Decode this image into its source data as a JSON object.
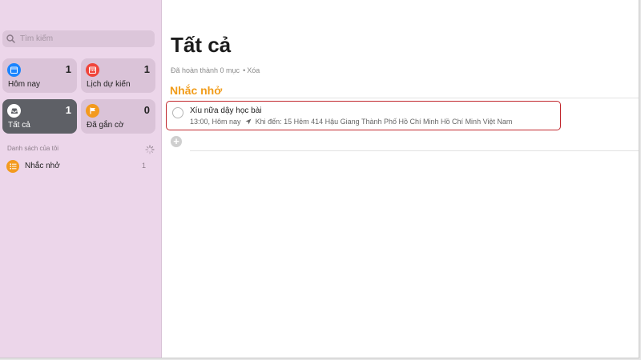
{
  "sidebar": {
    "search": {
      "placeholder": "Tìm kiếm"
    },
    "smart_lists": [
      {
        "label": "Hôm nay",
        "count": "1",
        "icon": "calendar-today-icon",
        "color": "#1a84ff"
      },
      {
        "label": "Lịch dự kiến",
        "count": "1",
        "icon": "calendar-scheduled-icon",
        "color": "#f0443a"
      },
      {
        "label": "Tất cả",
        "count": "1",
        "icon": "tray-icon",
        "color": "#5e6066",
        "selected": true
      },
      {
        "label": "Đã gắn cờ",
        "count": "0",
        "icon": "flag-icon",
        "color": "#f39a1e"
      }
    ],
    "my_lists_title": "Danh sách của tôi",
    "lists": [
      {
        "label": "Nhắc nhở",
        "count": "1",
        "icon": "list-icon",
        "color": "#f39a1e"
      }
    ]
  },
  "main": {
    "title": "Tất cả",
    "completed_text": "Đã hoàn thành 0 mục",
    "separator": "•",
    "clear_label": "Xóa",
    "section_title": "Nhắc nhở",
    "reminders": [
      {
        "title": "Xíu nữa dậy học bài",
        "time": "13:00, Hôm nay",
        "location": "Khi đến: 15 Hẻm 414 Hậu Giang Thành Phố Hồ Chí Minh Hồ Chí Minh Việt Nam"
      }
    ]
  },
  "colors": {
    "sidebar_bg": "#ecd6ea",
    "accent_orange": "#f19c1a",
    "highlight_red": "#c1272d",
    "selected_card": "#5e6066"
  }
}
